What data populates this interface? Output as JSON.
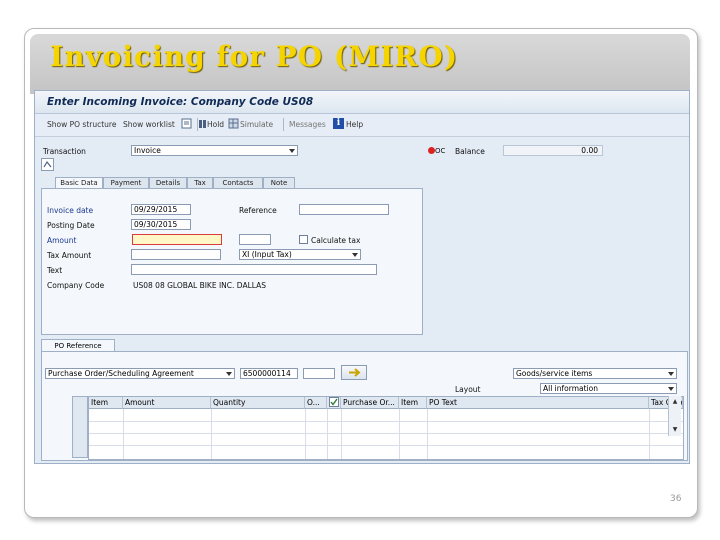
{
  "slide": {
    "title": "Invoicing for PO (MIRO)",
    "page_number": "36"
  },
  "sap": {
    "screen_title": "Enter Incoming Invoice: Company Code US08",
    "toolbar": {
      "show_po_structure": "Show PO structure",
      "show_worklist": "Show worklist",
      "hold": "Hold",
      "simulate": "Simulate",
      "messages": "Messages",
      "help": "Help"
    },
    "transaction": {
      "label": "Transaction",
      "value": "Invoice"
    },
    "balance": {
      "label": "Balance",
      "value": "0.00"
    },
    "tabs": [
      "Basic Data",
      "Payment",
      "Details",
      "Tax",
      "Contacts",
      "Note"
    ],
    "basic_data": {
      "invoice_date": {
        "label": "Invoice date",
        "value": "09/29/2015"
      },
      "posting_date": {
        "label": "Posting Date",
        "value": "09/30/2015"
      },
      "reference": {
        "label": "Reference",
        "value": ""
      },
      "amount": {
        "label": "Amount",
        "value": ""
      },
      "calculate_tax": {
        "label": "Calculate tax",
        "checked": false
      },
      "tax_amount": {
        "label": "Tax Amount",
        "value": "",
        "tax_code": "XI (Input Tax)"
      },
      "text": {
        "label": "Text",
        "value": ""
      },
      "company_code": {
        "label": "Company Code",
        "value": "US08 08 GLOBAL BIKE INC. DALLAS"
      }
    },
    "po_reference": {
      "tab_label": "PO Reference",
      "doc_type": "Purchase Order/Scheduling Agreement",
      "po_number": "6500000114",
      "item_filter": "Goods/service items",
      "layout_label": "Layout",
      "layout_value": "All information"
    },
    "grid_columns": [
      "Item",
      "Amount",
      "Quantity",
      "O...",
      "",
      "Purchase Or...",
      "Item",
      "PO Text",
      "Tax Code"
    ]
  }
}
